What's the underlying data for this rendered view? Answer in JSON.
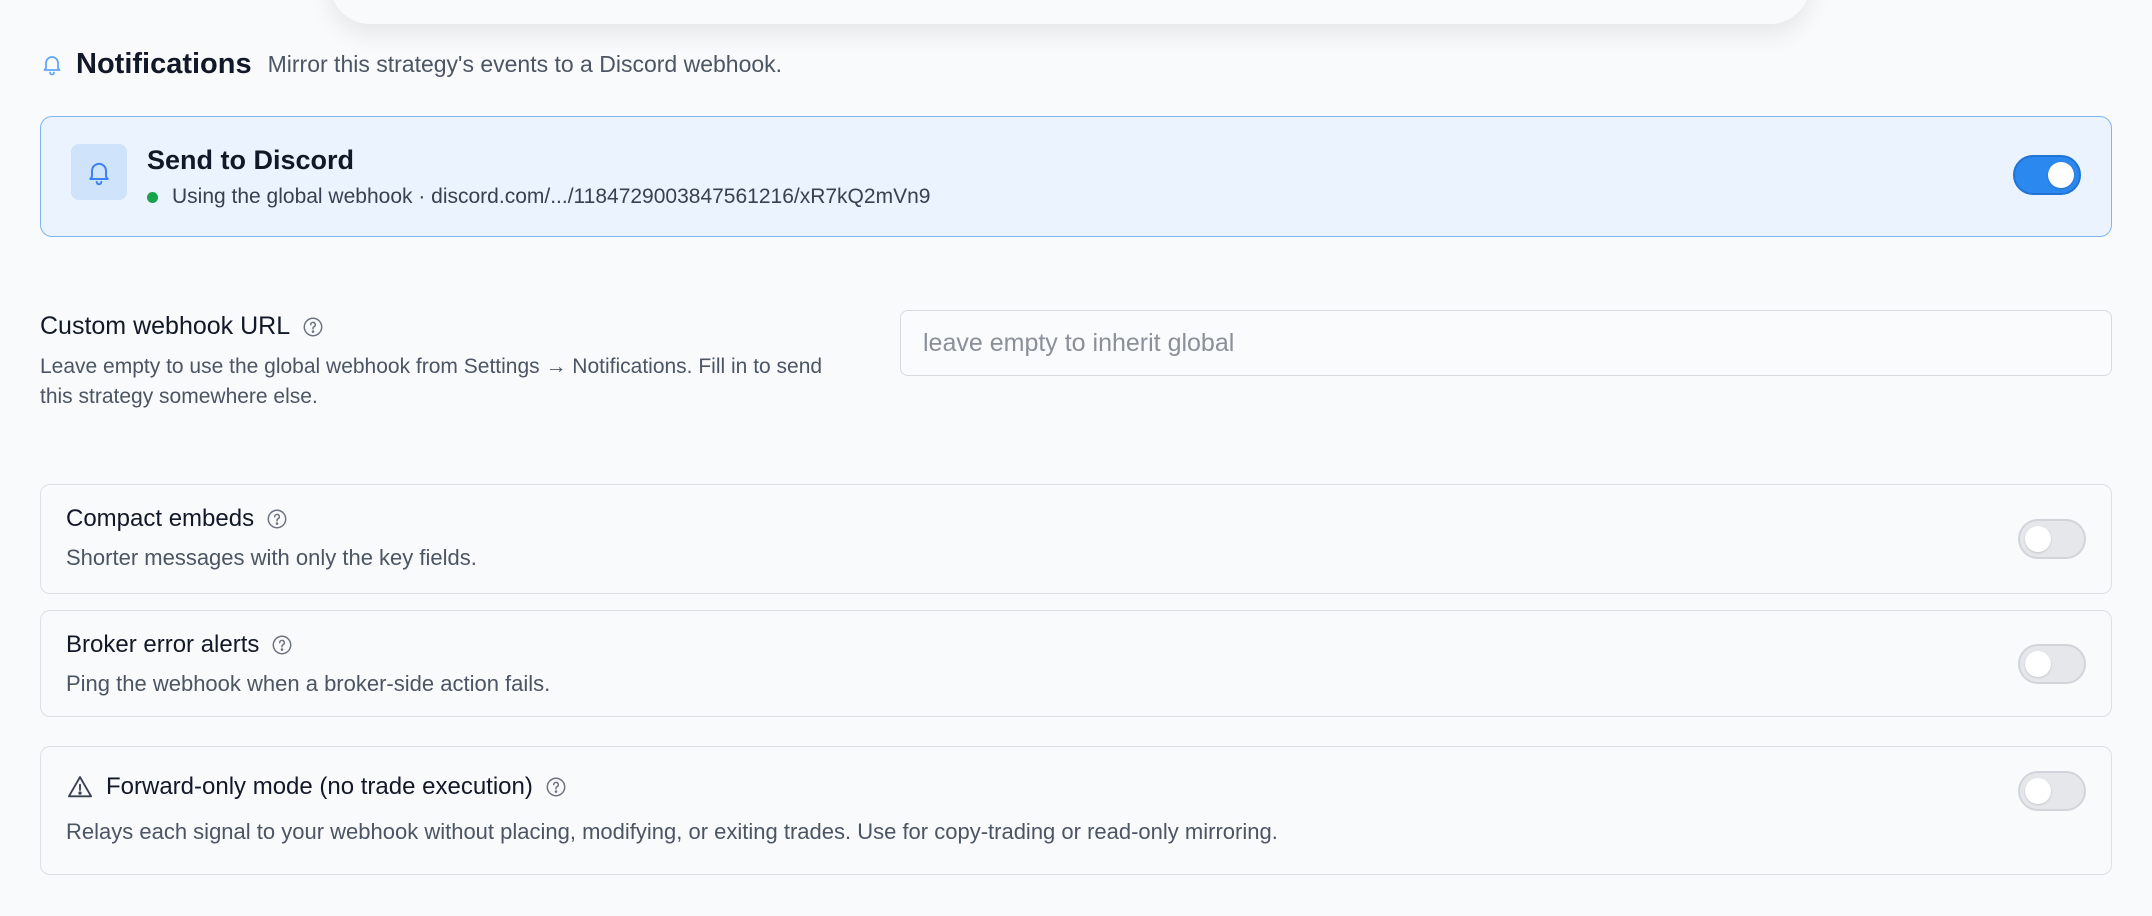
{
  "header": {
    "icon": "bell-icon",
    "title": "Notifications",
    "description": "Mirror this strategy's events to a Discord webhook."
  },
  "discord": {
    "icon": "bell-icon",
    "title": "Send to Discord",
    "status": "Using the global webhook · discord.com/.../1184729003847561216/xR7kQ2mVn9",
    "status_color": "#16a34a",
    "enabled": true
  },
  "custom_webhook": {
    "label": "Custom webhook URL",
    "description": "Leave empty to use the global webhook from Settings → Notifications. Fill in to send this strategy somewhere else.",
    "value": "",
    "placeholder": "leave empty to inherit global"
  },
  "options": [
    {
      "title": "Compact embeds",
      "description": "Shorter messages with only the key fields.",
      "enabled": false
    },
    {
      "title": "Broker error alerts",
      "description": "Ping the webhook when a broker-side action fails.",
      "enabled": false
    },
    {
      "icon": "warning-icon",
      "title": "Forward-only mode (no trade execution)",
      "description": "Relays each signal to your webhook without placing, modifying, or exiting trades. Use for copy-trading or read-only mirroring.",
      "enabled": false
    }
  ],
  "colors": {
    "accent": "#2b88ee",
    "card_bg": "#ebf3fe",
    "card_border": "#7db6f3"
  }
}
